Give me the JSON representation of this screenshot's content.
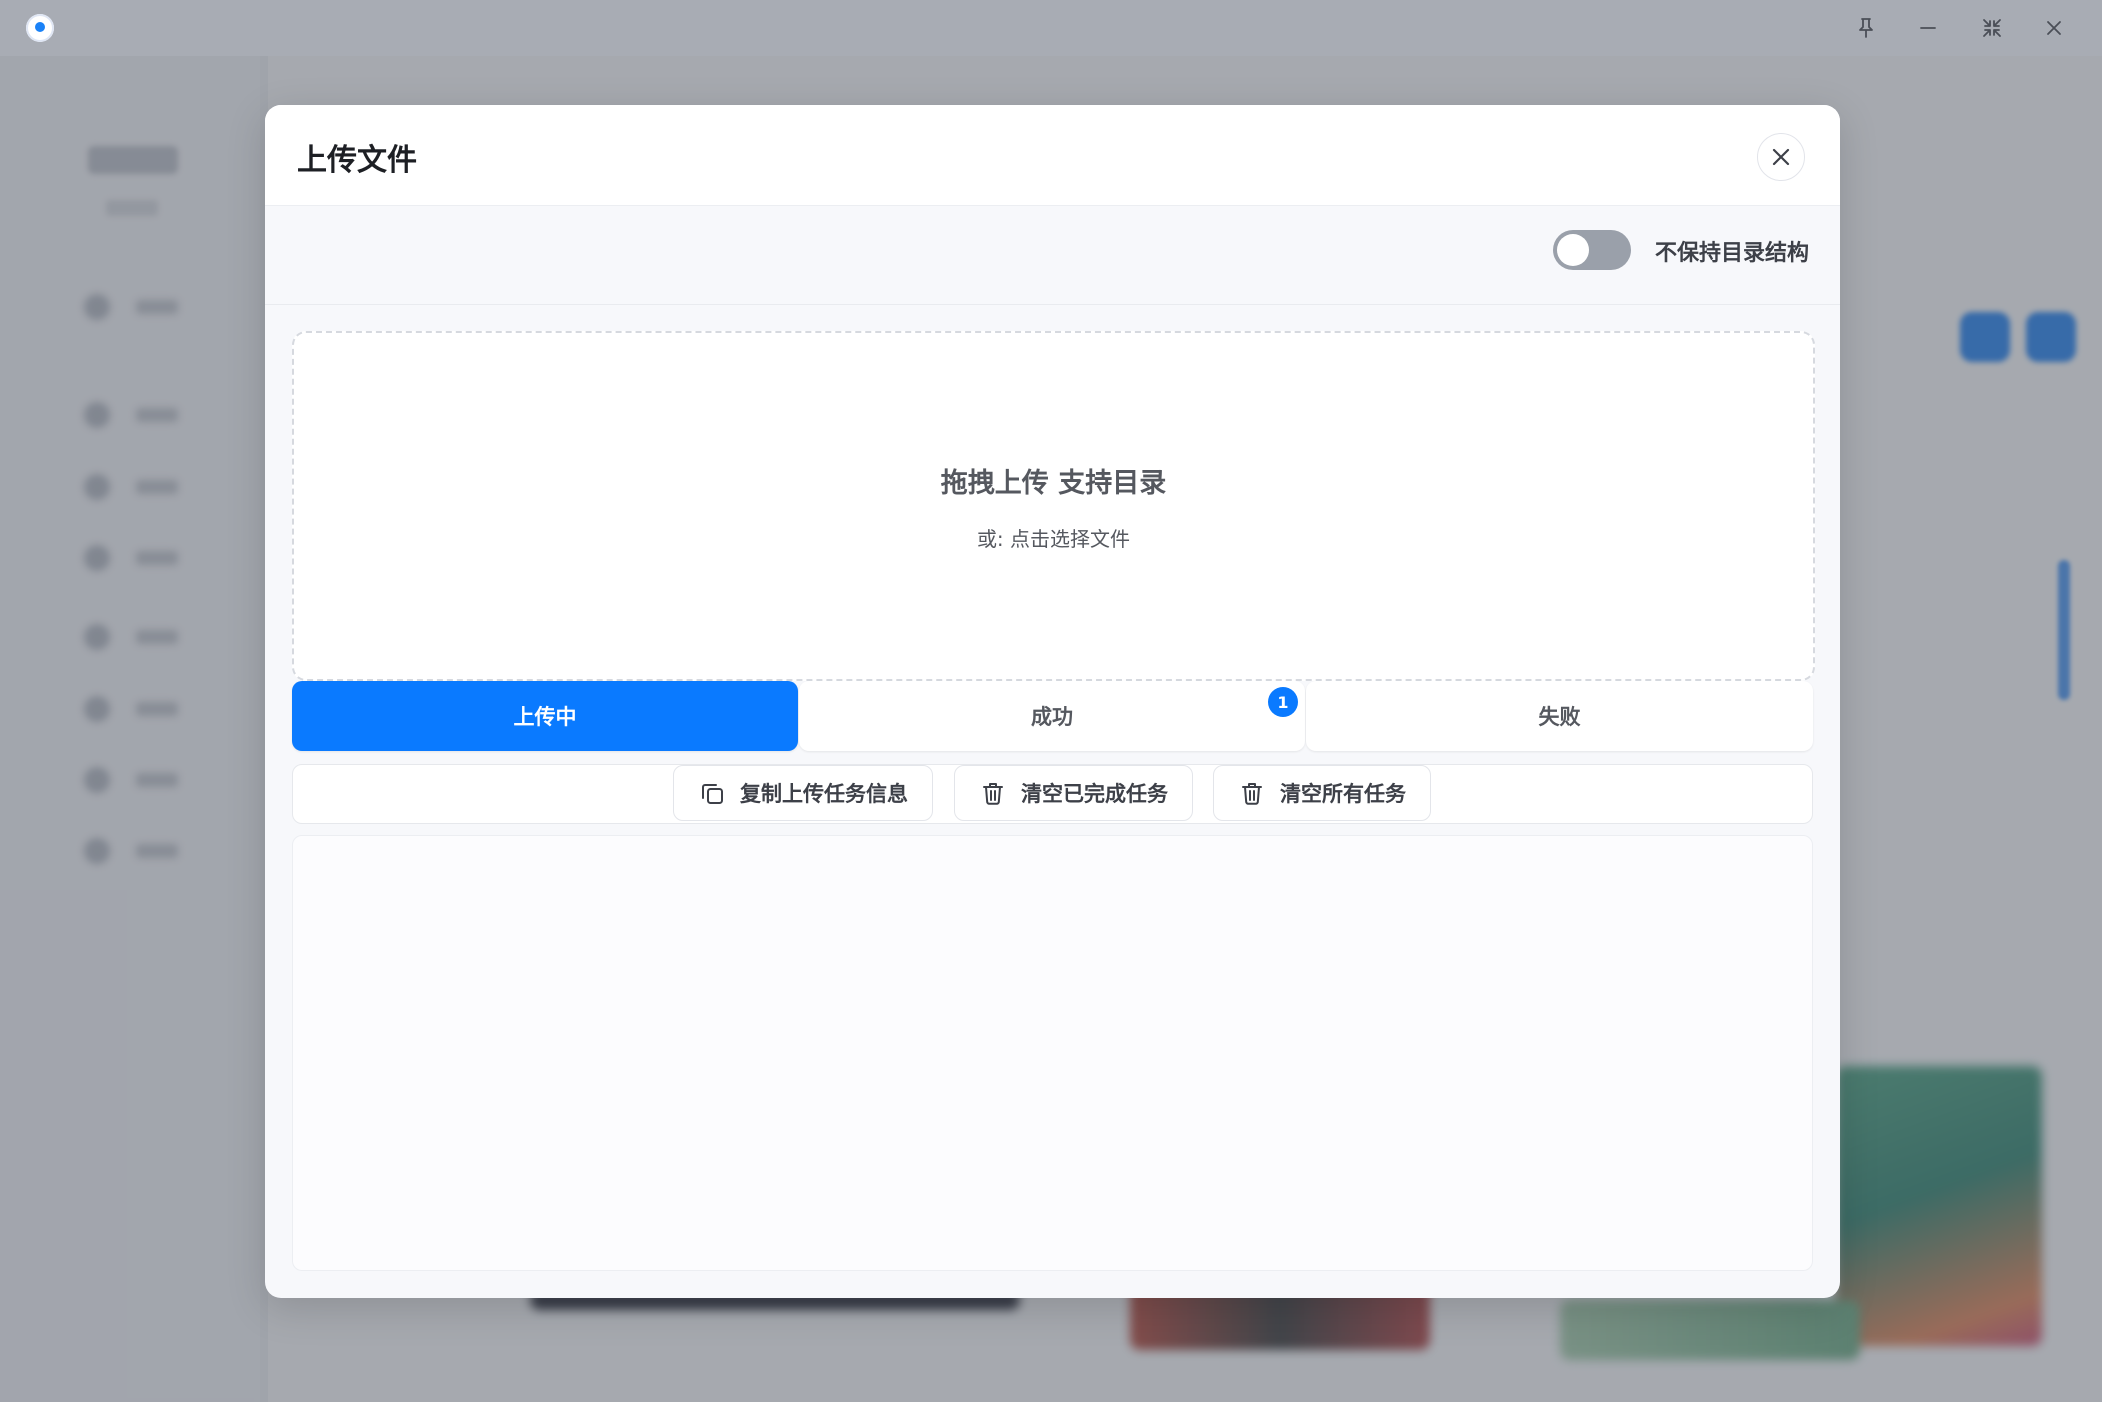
{
  "window": {
    "controls": [
      "pin-icon",
      "minimize-icon",
      "restore-icon",
      "close-icon"
    ]
  },
  "modal": {
    "title": "上传文件",
    "toggle": {
      "label": "不保持目录结构",
      "on": false
    },
    "dropzone": {
      "title": "拖拽上传 支持目录",
      "subtitle": "或: 点击选择文件"
    },
    "tabs": [
      {
        "label": "上传中",
        "active": true
      },
      {
        "label": "成功",
        "active": false,
        "badge": "1"
      },
      {
        "label": "失败",
        "active": false
      }
    ],
    "actions": [
      {
        "label": "复制上传任务信息",
        "icon": "copy-icon"
      },
      {
        "label": "清空已完成任务",
        "icon": "trash-icon"
      },
      {
        "label": "清空所有任务",
        "icon": "trash-icon"
      }
    ]
  },
  "colors": {
    "accent": "#0a7aff",
    "toggle_off": "#9aa0aa"
  }
}
